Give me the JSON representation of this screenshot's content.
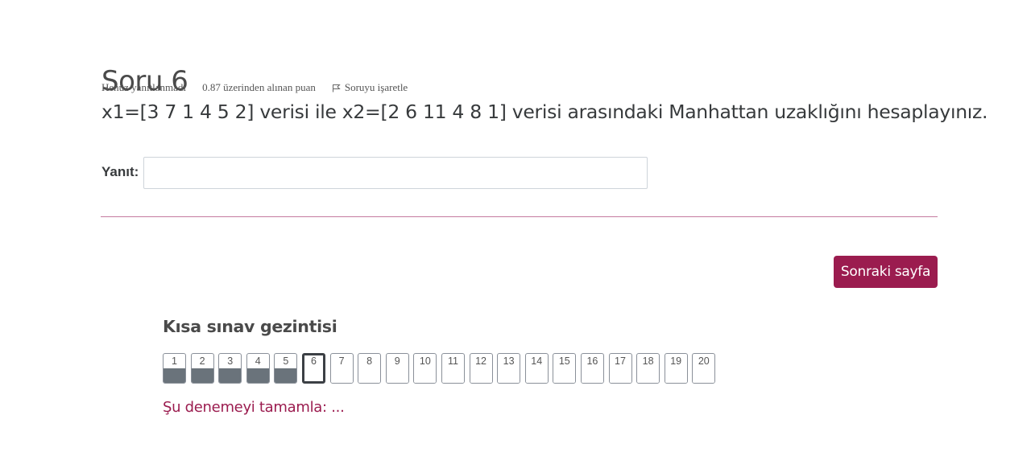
{
  "question": {
    "title": "Soru 6",
    "status": "Henüz yanıtlanmadı",
    "grade": "0.87 üzerinden alınan puan",
    "flag_label": "Soruyu işaretle",
    "text": "x1=[3 7 1 4 5 2] verisi ile x2=[2 6 11 4 8 1] verisi arasındaki Manhattan uzaklığını hesaplayınız.",
    "answer_label": "Yanıt:",
    "answer_value": ""
  },
  "next_button": "Sonraki sayfa",
  "navigation": {
    "title": "Kısa sınav gezintisi",
    "current": 6,
    "questions": [
      {
        "num": "1",
        "state": "answered"
      },
      {
        "num": "2",
        "state": "answered"
      },
      {
        "num": "3",
        "state": "answered"
      },
      {
        "num": "4",
        "state": "answered"
      },
      {
        "num": "5",
        "state": "answered"
      },
      {
        "num": "6",
        "state": "current"
      },
      {
        "num": "7",
        "state": "notyet"
      },
      {
        "num": "8",
        "state": "notyet"
      },
      {
        "num": "9",
        "state": "notyet"
      },
      {
        "num": "10",
        "state": "notyet"
      },
      {
        "num": "11",
        "state": "notyet"
      },
      {
        "num": "12",
        "state": "notyet"
      },
      {
        "num": "13",
        "state": "notyet"
      },
      {
        "num": "14",
        "state": "notyet"
      },
      {
        "num": "15",
        "state": "notyet"
      },
      {
        "num": "16",
        "state": "notyet"
      },
      {
        "num": "17",
        "state": "notyet"
      },
      {
        "num": "18",
        "state": "notyet"
      },
      {
        "num": "19",
        "state": "notyet"
      },
      {
        "num": "20",
        "state": "notyet"
      }
    ],
    "finish_link": "Şu denemeyi tamamla: ..."
  },
  "colors": {
    "accent": "#9b1c4f",
    "answered": "#6a737b",
    "divider": "#c47aa0"
  }
}
